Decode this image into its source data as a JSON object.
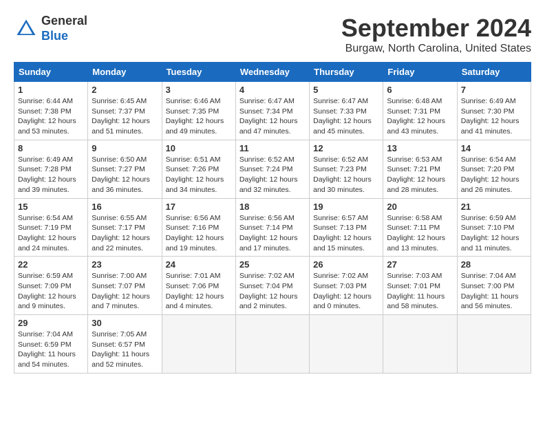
{
  "header": {
    "logo_general": "General",
    "logo_blue": "Blue",
    "month_title": "September 2024",
    "location": "Burgaw, North Carolina, United States"
  },
  "weekdays": [
    "Sunday",
    "Monday",
    "Tuesday",
    "Wednesday",
    "Thursday",
    "Friday",
    "Saturday"
  ],
  "weeks": [
    [
      {
        "day": 1,
        "sunrise": "6:44 AM",
        "sunset": "7:38 PM",
        "daylight": "12 hours and 53 minutes."
      },
      {
        "day": 2,
        "sunrise": "6:45 AM",
        "sunset": "7:37 PM",
        "daylight": "12 hours and 51 minutes."
      },
      {
        "day": 3,
        "sunrise": "6:46 AM",
        "sunset": "7:35 PM",
        "daylight": "12 hours and 49 minutes."
      },
      {
        "day": 4,
        "sunrise": "6:47 AM",
        "sunset": "7:34 PM",
        "daylight": "12 hours and 47 minutes."
      },
      {
        "day": 5,
        "sunrise": "6:47 AM",
        "sunset": "7:33 PM",
        "daylight": "12 hours and 45 minutes."
      },
      {
        "day": 6,
        "sunrise": "6:48 AM",
        "sunset": "7:31 PM",
        "daylight": "12 hours and 43 minutes."
      },
      {
        "day": 7,
        "sunrise": "6:49 AM",
        "sunset": "7:30 PM",
        "daylight": "12 hours and 41 minutes."
      }
    ],
    [
      {
        "day": 8,
        "sunrise": "6:49 AM",
        "sunset": "7:28 PM",
        "daylight": "12 hours and 39 minutes."
      },
      {
        "day": 9,
        "sunrise": "6:50 AM",
        "sunset": "7:27 PM",
        "daylight": "12 hours and 36 minutes."
      },
      {
        "day": 10,
        "sunrise": "6:51 AM",
        "sunset": "7:26 PM",
        "daylight": "12 hours and 34 minutes."
      },
      {
        "day": 11,
        "sunrise": "6:52 AM",
        "sunset": "7:24 PM",
        "daylight": "12 hours and 32 minutes."
      },
      {
        "day": 12,
        "sunrise": "6:52 AM",
        "sunset": "7:23 PM",
        "daylight": "12 hours and 30 minutes."
      },
      {
        "day": 13,
        "sunrise": "6:53 AM",
        "sunset": "7:21 PM",
        "daylight": "12 hours and 28 minutes."
      },
      {
        "day": 14,
        "sunrise": "6:54 AM",
        "sunset": "7:20 PM",
        "daylight": "12 hours and 26 minutes."
      }
    ],
    [
      {
        "day": 15,
        "sunrise": "6:54 AM",
        "sunset": "7:19 PM",
        "daylight": "12 hours and 24 minutes."
      },
      {
        "day": 16,
        "sunrise": "6:55 AM",
        "sunset": "7:17 PM",
        "daylight": "12 hours and 22 minutes."
      },
      {
        "day": 17,
        "sunrise": "6:56 AM",
        "sunset": "7:16 PM",
        "daylight": "12 hours and 19 minutes."
      },
      {
        "day": 18,
        "sunrise": "6:56 AM",
        "sunset": "7:14 PM",
        "daylight": "12 hours and 17 minutes."
      },
      {
        "day": 19,
        "sunrise": "6:57 AM",
        "sunset": "7:13 PM",
        "daylight": "12 hours and 15 minutes."
      },
      {
        "day": 20,
        "sunrise": "6:58 AM",
        "sunset": "7:11 PM",
        "daylight": "12 hours and 13 minutes."
      },
      {
        "day": 21,
        "sunrise": "6:59 AM",
        "sunset": "7:10 PM",
        "daylight": "12 hours and 11 minutes."
      }
    ],
    [
      {
        "day": 22,
        "sunrise": "6:59 AM",
        "sunset": "7:09 PM",
        "daylight": "12 hours and 9 minutes."
      },
      {
        "day": 23,
        "sunrise": "7:00 AM",
        "sunset": "7:07 PM",
        "daylight": "12 hours and 7 minutes."
      },
      {
        "day": 24,
        "sunrise": "7:01 AM",
        "sunset": "7:06 PM",
        "daylight": "12 hours and 4 minutes."
      },
      {
        "day": 25,
        "sunrise": "7:02 AM",
        "sunset": "7:04 PM",
        "daylight": "12 hours and 2 minutes."
      },
      {
        "day": 26,
        "sunrise": "7:02 AM",
        "sunset": "7:03 PM",
        "daylight": "12 hours and 0 minutes."
      },
      {
        "day": 27,
        "sunrise": "7:03 AM",
        "sunset": "7:01 PM",
        "daylight": "11 hours and 58 minutes."
      },
      {
        "day": 28,
        "sunrise": "7:04 AM",
        "sunset": "7:00 PM",
        "daylight": "11 hours and 56 minutes."
      }
    ],
    [
      {
        "day": 29,
        "sunrise": "7:04 AM",
        "sunset": "6:59 PM",
        "daylight": "11 hours and 54 minutes."
      },
      {
        "day": 30,
        "sunrise": "7:05 AM",
        "sunset": "6:57 PM",
        "daylight": "11 hours and 52 minutes."
      },
      null,
      null,
      null,
      null,
      null
    ]
  ]
}
